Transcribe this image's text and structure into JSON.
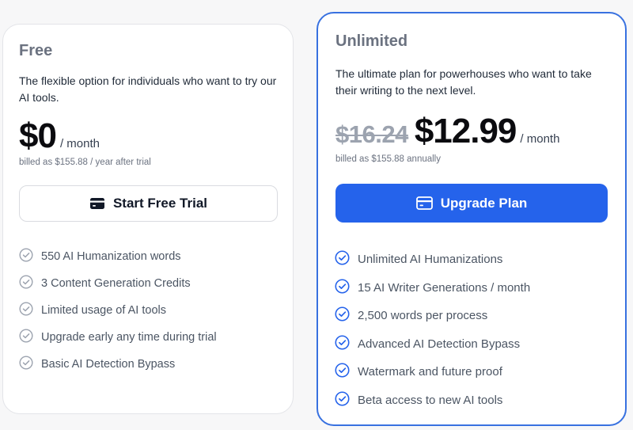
{
  "plans": {
    "free": {
      "name": "Free",
      "description": "The flexible option for individuals who want to try our AI tools.",
      "price": "$0",
      "period": "/ month",
      "billed": "billed as $155.88 / year after trial",
      "button_label": "Start Free Trial",
      "button_icon": "credit-card-icon",
      "feature_icon": "check-circle-icon",
      "features": [
        "550 AI Humanization words",
        "3 Content Generation Credits",
        "Limited usage of AI tools",
        "Upgrade early any time during trial",
        "Basic AI Detection Bypass"
      ]
    },
    "unlimited": {
      "name": "Unlimited",
      "description": "The ultimate plan for powerhouses who want to take their writing to the next level.",
      "old_price": "$16.24",
      "price": "$12.99",
      "period": "/ month",
      "billed": "billed as $155.88 annually",
      "button_label": "Upgrade Plan",
      "button_icon": "credit-card-icon",
      "feature_icon": "check-circle-icon",
      "features": [
        "Unlimited AI Humanizations",
        "15 AI Writer Generations / month",
        "2,500 words per process",
        "Advanced AI Detection Bypass",
        "Watermark and future proof",
        "Beta access to new AI tools"
      ]
    }
  },
  "colors": {
    "accent": "#2563eb",
    "accent_border": "#3871e0",
    "muted_check": "#9ca3af",
    "page_background": "#f7f7f8"
  }
}
